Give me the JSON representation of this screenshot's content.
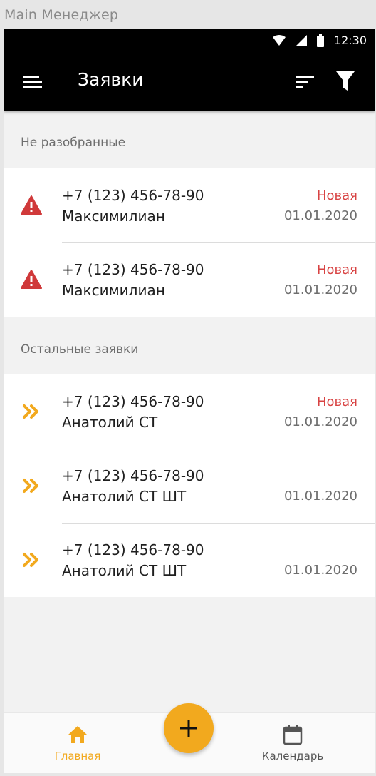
{
  "window_title": "Main Менеджер",
  "status_bar": {
    "time": "12:30"
  },
  "app_bar": {
    "title": "Заявки"
  },
  "sections": [
    {
      "header": "Не разобранные",
      "items": [
        {
          "phone": "+7 (123) 456-78-90",
          "name": "Максимилиан",
          "status": "Новая",
          "date": "01.01.2020",
          "icon": "warning-icon"
        },
        {
          "phone": "+7 (123) 456-78-90",
          "name": "Максимилиан",
          "status": "Новая",
          "date": "01.01.2020",
          "icon": "warning-icon"
        }
      ]
    },
    {
      "header": "Остальные заявки",
      "items": [
        {
          "phone": "+7 (123) 456-78-90",
          "name": "Анатолий СТ",
          "status": "Новая",
          "date": "01.01.2020",
          "icon": "double-chevron-right-icon"
        },
        {
          "phone": "+7 (123) 456-78-90",
          "name": "Анатолий СТ ШТ",
          "status": "",
          "date": "01.01.2020",
          "icon": "double-chevron-right-icon"
        },
        {
          "phone": "+7 (123) 456-78-90",
          "name": "Анатолий СТ ШТ",
          "status": "",
          "date": "01.01.2020",
          "icon": "double-chevron-right-icon"
        }
      ]
    }
  ],
  "bottom_nav": {
    "home_label": "Главная",
    "calendar_label": "Календарь"
  },
  "colors": {
    "accent": "#f2a91e",
    "status_new": "#d84343",
    "warning": "#d0393a",
    "app_bar": "#000000"
  }
}
